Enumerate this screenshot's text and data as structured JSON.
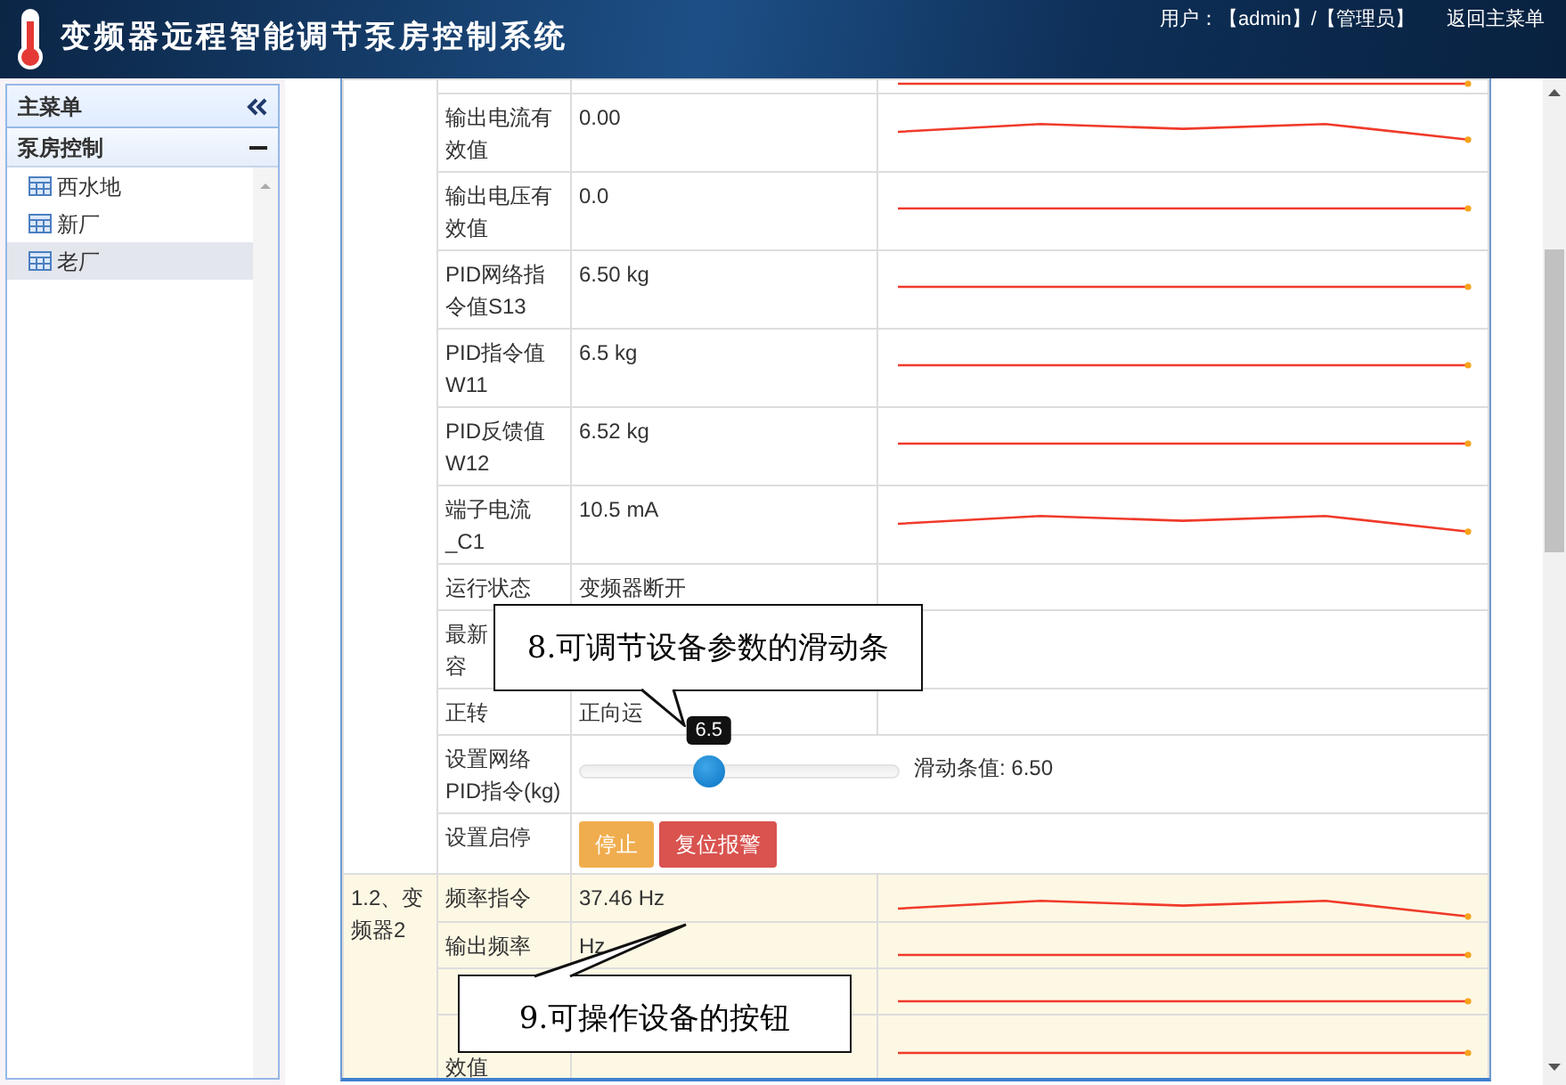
{
  "header": {
    "title": "变频器远程智能调节泵房控制系统",
    "user_text": "用户：【admin】/【管理员】",
    "home_link": "返回主菜单"
  },
  "sidebar": {
    "title": "主菜单",
    "sections": [
      {
        "title": "泵房控制",
        "expanded": true,
        "items": [
          {
            "label": "西水地",
            "selected": false
          },
          {
            "label": "新厂",
            "selected": false
          },
          {
            "label": "老厂",
            "selected": true
          }
        ]
      }
    ]
  },
  "table": {
    "groups": [
      {
        "highlighted": false,
        "rows": [
          {
            "kind": "reading",
            "trend": {
              "kind": "flat"
            }
          },
          {
            "kind": "reading",
            "label": "输出电流有效值",
            "value": "0.00",
            "trend": {
              "kind": "wave"
            }
          },
          {
            "kind": "reading",
            "label": "输出电压有效值",
            "value": "0.0",
            "trend": {
              "kind": "flat"
            }
          },
          {
            "kind": "reading",
            "label": "PID网络指令值S13",
            "value": "6.50 kg",
            "trend": {
              "kind": "flat"
            }
          },
          {
            "kind": "reading",
            "label": "PID指令值W11",
            "value": "6.5 kg",
            "trend": {
              "kind": "flat"
            }
          },
          {
            "kind": "reading",
            "label": "PID反馈值W12",
            "value": "6.52 kg",
            "trend": {
              "kind": "flat"
            }
          },
          {
            "kind": "reading",
            "label": "端子电流_C1",
            "value": "10.5 mA",
            "trend": {
              "kind": "wave"
            }
          },
          {
            "kind": "reading",
            "label": "运行状态",
            "value": "变频器断开"
          },
          {
            "kind": "reading",
            "label_lines": [
              "最新",
              "容"
            ]
          },
          {
            "kind": "reading",
            "label": "正转",
            "value": "正向运"
          },
          {
            "kind": "slider",
            "label": "设置网络PID指令(kg)",
            "level": 0.405,
            "tooltip": "6.5",
            "reading": "滑动条值: 6.50"
          },
          {
            "kind": "buttons",
            "label": "设置启停",
            "buttons": [
              {
                "label": "停止",
                "kind": "warning"
              },
              {
                "label": "复位报警",
                "kind": "danger"
              }
            ]
          }
        ]
      },
      {
        "highlighted": true,
        "label": "1.2、变频器2",
        "rows": [
          {
            "kind": "reading",
            "label": "频率指令",
            "value": "37.46 Hz",
            "trend": {
              "kind": "wave"
            }
          },
          {
            "kind": "reading",
            "label": "输出频率",
            "value": "Hz",
            "trend": {
              "kind": "flat"
            }
          },
          {
            "kind": "reading",
            "trend": {
              "kind": "flat"
            }
          },
          {
            "kind": "reading_tail",
            "label": "效值",
            "trend": {
              "kind": "flat"
            }
          }
        ]
      }
    ]
  },
  "callouts": [
    {
      "text": "8.可调节设备参数的滑动条",
      "kind": "down"
    },
    {
      "text": "9.可操作设备的按钮",
      "kind": "up"
    }
  ]
}
